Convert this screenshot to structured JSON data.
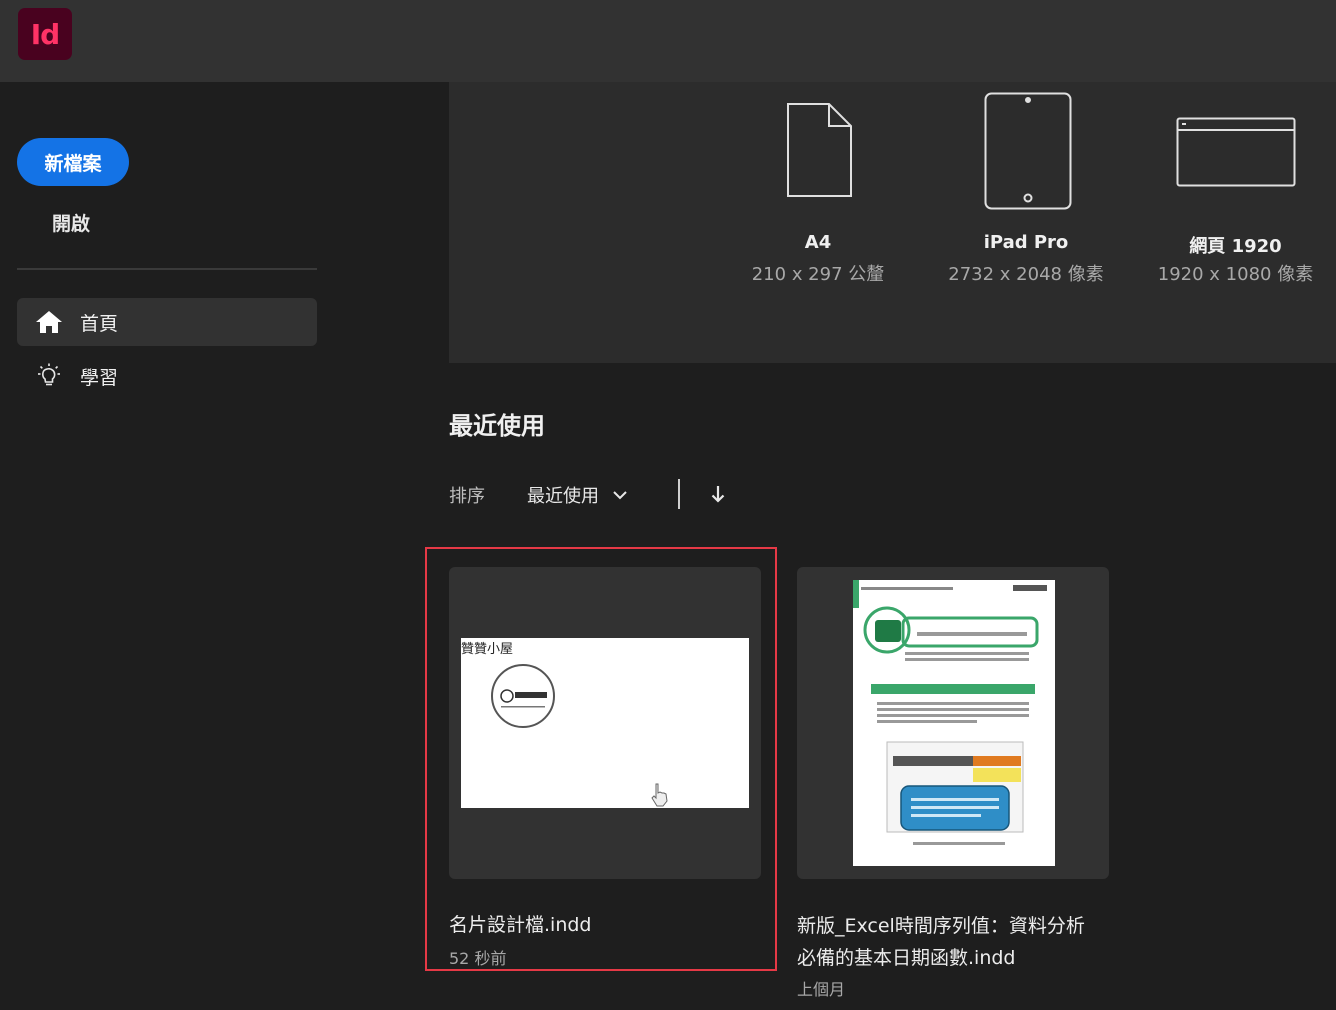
{
  "app": {
    "logo_text": "Id",
    "logo_bg": "#49021f",
    "logo_fg": "#ff3366"
  },
  "sidebar": {
    "new_button": "新檔案",
    "open_button": "開啟",
    "nav": [
      {
        "label": "首頁",
        "icon": "home-icon",
        "active": true
      },
      {
        "label": "學習",
        "icon": "lightbulb-icon",
        "active": false
      }
    ]
  },
  "presets": [
    {
      "name": "A4",
      "size": "210 x 297 公釐",
      "icon": "document-icon"
    },
    {
      "name": "iPad Pro",
      "size": "2732 x 2048 像素",
      "icon": "tablet-icon"
    },
    {
      "name": "網頁 1920",
      "size": "1920 x 1080 像素",
      "icon": "browser-window-icon"
    }
  ],
  "recent": {
    "title": "最近使用",
    "sort_label": "排序",
    "sort_value": "最近使用",
    "files": [
      {
        "name": "名片設計檔.indd",
        "time": "52 秒前",
        "thumb_text": "贊贊小屋",
        "selected": true
      },
      {
        "name_line1": "新版_Excel時間序列值：資料分析",
        "name_line2": "必備的基本日期函數.indd",
        "time": "上個月",
        "selected": false
      }
    ]
  },
  "colors": {
    "accent": "#1473e6",
    "selection": "#e63946"
  }
}
